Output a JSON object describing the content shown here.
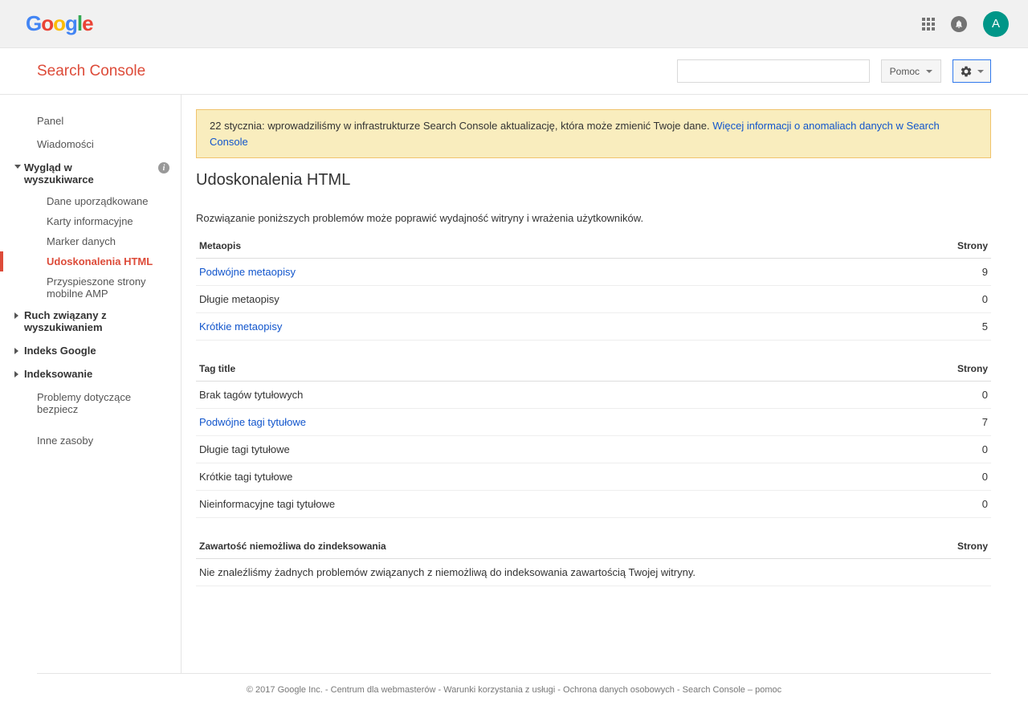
{
  "header": {
    "avatar_letter": "A"
  },
  "subheader": {
    "product": "Search Console",
    "help_label": "Pomoc"
  },
  "sidebar": {
    "panel": "Panel",
    "messages": "Wiadomości",
    "search_appearance": {
      "label": "Wygląd w wyszukiwarce",
      "items": [
        "Dane uporządkowane",
        "Karty informacyjne",
        "Marker danych",
        "Udoskonalenia HTML",
        "Przyspieszone strony mobilne AMP"
      ],
      "active_index": 3
    },
    "search_traffic": "Ruch związany z wyszukiwaniem",
    "google_index": "Indeks Google",
    "crawl": "Indeksowanie",
    "security": "Problemy dotyczące bezpiecz",
    "other": "Inne zasoby"
  },
  "notice": {
    "text": "22 stycznia: wprowadziliśmy w infrastrukturze Search Console aktualizację, która może zmienić Twoje dane. ",
    "link": "Więcej informacji o anomaliach danych w Search Console"
  },
  "page": {
    "title": "Udoskonalenia HTML",
    "intro": "Rozwiązanie poniższych problemów może poprawić wydajność witryny i wrażenia użytkowników."
  },
  "tables": {
    "meta": {
      "header_left": "Metaopis",
      "header_right": "Strony",
      "rows": [
        {
          "label": "Podwójne metaopisy",
          "count": 9,
          "link": true
        },
        {
          "label": "Długie metaopisy",
          "count": 0,
          "link": false
        },
        {
          "label": "Krótkie metaopisy",
          "count": 5,
          "link": true
        }
      ]
    },
    "title": {
      "header_left": "Tag title",
      "header_right": "Strony",
      "rows": [
        {
          "label": "Brak tagów tytułowych",
          "count": 0,
          "link": false
        },
        {
          "label": "Podwójne tagi tytułowe",
          "count": 7,
          "link": true
        },
        {
          "label": "Długie tagi tytułowe",
          "count": 0,
          "link": false
        },
        {
          "label": "Krótkie tagi tytułowe",
          "count": 0,
          "link": false
        },
        {
          "label": "Nieinformacyjne tagi tytułowe",
          "count": 0,
          "link": false
        }
      ]
    },
    "nonindex": {
      "header_left": "Zawartość niemożliwa do zindeksowania",
      "header_right": "Strony",
      "message": "Nie znaleźliśmy żadnych problemów związanych z niemożliwą do indeksowania zawartością Twojej witryny."
    }
  },
  "footer": {
    "copyright": "© 2017 Google Inc.",
    "links": [
      "Centrum dla webmasterów",
      "Warunki korzystania z usługi",
      "Ochrona danych osobowych",
      "Search Console – pomoc"
    ]
  }
}
